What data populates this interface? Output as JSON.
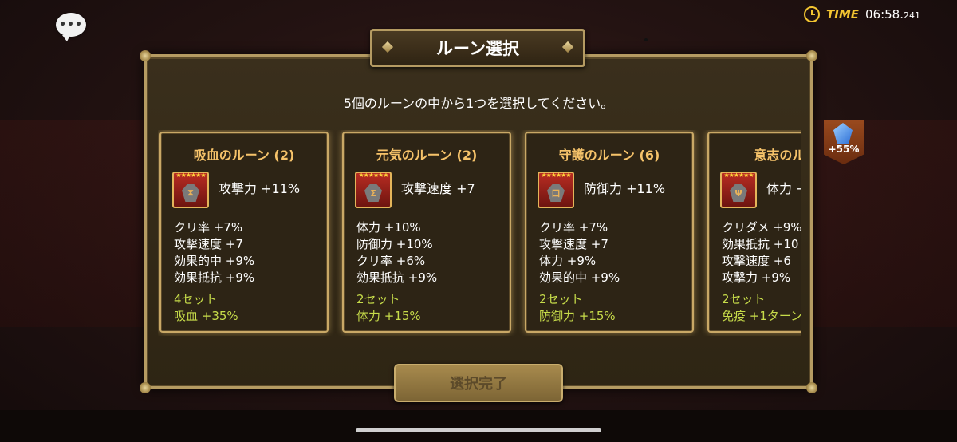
{
  "time": {
    "label": "TIME",
    "value": "06:58.",
    "ms": "241"
  },
  "dialog": {
    "title": "ルーン選択",
    "instruction": "5個のルーンの中から1つを選択してください。",
    "confirm_label": "選択完了"
  },
  "side_gem": {
    "label": "+55%"
  },
  "cards": [
    {
      "title": "吸血のルーン (2)",
      "stars": "★★★★★★",
      "symbol": "⧗",
      "main": "攻撃力 +11%",
      "subs": [
        "クリ率 +7%",
        "攻撃速度 +7",
        "効果的中 +9%",
        "効果抵抗 +9%"
      ],
      "set_count": "4セット",
      "set_effect": "吸血 +35%"
    },
    {
      "title": "元気のルーン (2)",
      "stars": "★★★★★★",
      "symbol": "Σ",
      "main": "攻撃速度 +7",
      "subs": [
        "体力 +10%",
        "防御力 +10%",
        "クリ率 +6%",
        "効果抵抗 +9%"
      ],
      "set_count": "2セット",
      "set_effect": "体力 +15%"
    },
    {
      "title": "守護のルーン (6)",
      "stars": "★★★★★★",
      "symbol": "口",
      "main": "防御力 +11%",
      "subs": [
        "クリ率 +7%",
        "攻撃速度 +7",
        "体力 +9%",
        "効果的中 +9%"
      ],
      "set_count": "2セット",
      "set_effect": "防御力 +15%"
    },
    {
      "title": "意志のルーン",
      "stars": "★★★★★★",
      "symbol": "Ψ",
      "main": "体力 +",
      "subs": [
        "クリダメ +9%",
        "効果抵抗 +10",
        "攻撃速度 +6",
        "攻撃力 +9%"
      ],
      "set_count": "2セット",
      "set_effect": "免疫 +1ターン"
    }
  ]
}
